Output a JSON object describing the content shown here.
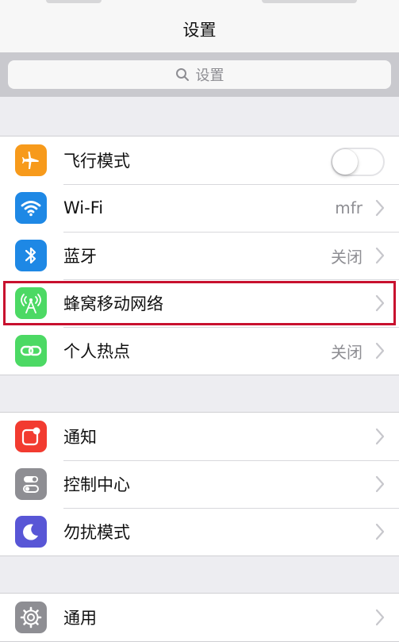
{
  "header": {
    "title": "设置"
  },
  "search": {
    "placeholder": "设置",
    "icon": "search-icon"
  },
  "colors": {
    "page_background": "#ededf1",
    "search_band": "#c9c9ce",
    "highlight_box": "#c8102e",
    "value_text": "#8e8e93"
  },
  "groups": [
    {
      "rows": [
        {
          "label": "飞行模式",
          "icon": "airplane-icon",
          "icon_color": "#f79a1b",
          "control": "toggle",
          "toggle_on": false
        },
        {
          "label": "Wi-Fi",
          "icon": "wifi-icon",
          "icon_color": "#1e88e5",
          "value": "mfr",
          "control": "chevron"
        },
        {
          "label": "蓝牙",
          "icon": "bluetooth-icon",
          "icon_color": "#1e88e5",
          "value": "关闭",
          "control": "chevron"
        },
        {
          "label": "蜂窝移动网络",
          "icon": "cellular-antenna-icon",
          "icon_color": "#4cd964",
          "control": "chevron",
          "highlighted": true
        },
        {
          "label": "个人热点",
          "icon": "personal-hotspot-icon",
          "icon_color": "#4cd964",
          "value": "关闭",
          "control": "chevron"
        }
      ]
    },
    {
      "rows": [
        {
          "label": "通知",
          "icon": "notifications-icon",
          "icon_color": "#f23b30",
          "control": "chevron"
        },
        {
          "label": "控制中心",
          "icon": "control-center-icon",
          "icon_color": "#8e8e93",
          "control": "chevron"
        },
        {
          "label": "勿扰模式",
          "icon": "moon-icon",
          "icon_color": "#5856d6",
          "control": "chevron"
        }
      ]
    },
    {
      "rows": [
        {
          "label": "通用",
          "icon": "gear-icon",
          "icon_color": "#8e8e93",
          "control": "chevron"
        }
      ]
    }
  ]
}
